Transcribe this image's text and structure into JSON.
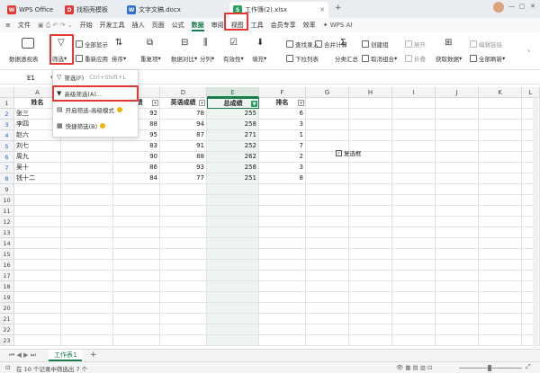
{
  "tabs": [
    {
      "label": "WPS Office",
      "icon": "wps-logo-icon"
    },
    {
      "label": "找稻壳模板",
      "icon": "docer-icon"
    },
    {
      "label": "文字文稿.docx",
      "icon": "word-doc-icon"
    },
    {
      "label": "工作簿(2).xlsx",
      "icon": "spreadsheet-icon"
    }
  ],
  "menu": [
    "文件",
    "开始",
    "开发工具",
    "插入",
    "页面",
    "公式",
    "数据",
    "审阅",
    "视图",
    "工具",
    "会员专享",
    "效率"
  ],
  "menu_active": "数据",
  "wps_ai": "WPS AI",
  "share": "分享",
  "ribbon": {
    "pivot": "数据透视表",
    "filter": "筛选",
    "show_all": "全部显示",
    "reapply": "重新应用",
    "sort": "排序",
    "repeat": "重复项",
    "compare": "数据对比",
    "split": "分列",
    "validity": "有效性",
    "fill": "填充",
    "find_entry": "查找录入",
    "merge_calc": "合并计算",
    "dropdown_list": "下拉列表",
    "create_group": "创建组",
    "expand": "展开",
    "subtotal": "分类汇总",
    "ungroup": "取消组合",
    "collapse": "折叠",
    "edit_link": "编辑链接",
    "get_data": "获取数据",
    "refresh_all": "全部刷新"
  },
  "namebox": "E1",
  "columns": [
    "A",
    "B",
    "C",
    "D",
    "E",
    "F",
    "G",
    "H",
    "I",
    "J",
    "K",
    "L"
  ],
  "headers": {
    "a": "姓名",
    "c": "成绩",
    "d": "英语成绩",
    "e": "总成绩",
    "f": "排名"
  },
  "rows": [
    {
      "num": "1"
    },
    {
      "num": "2",
      "name": "张三",
      "c": "92",
      "d": "78",
      "e": "255",
      "f": "6"
    },
    {
      "num": "3",
      "name": "李四",
      "c": "88",
      "d": "94",
      "e": "258",
      "f": "3"
    },
    {
      "num": "4",
      "name": "赵六",
      "c": "95",
      "d": "87",
      "e": "271",
      "f": "1"
    },
    {
      "num": "5",
      "name": "刘七",
      "c": "83",
      "d": "91",
      "e": "252",
      "f": "7"
    },
    {
      "num": "6",
      "name": "周九",
      "c": "90",
      "d": "88",
      "e": "262",
      "f": "2"
    },
    {
      "num": "7",
      "name": "吴十",
      "c": "86",
      "d": "93",
      "e": "258",
      "f": "3"
    },
    {
      "num": "8",
      "name": "钱十二",
      "c": "84",
      "d": "77",
      "e": "251",
      "f": "8"
    },
    {
      "num": "9"
    },
    {
      "num": "10"
    },
    {
      "num": "11"
    },
    {
      "num": "12"
    },
    {
      "num": "13"
    },
    {
      "num": "14"
    },
    {
      "num": "15"
    },
    {
      "num": "16"
    },
    {
      "num": "17"
    },
    {
      "num": "18"
    },
    {
      "num": "19"
    },
    {
      "num": "20"
    },
    {
      "num": "21"
    },
    {
      "num": "22"
    },
    {
      "num": "23"
    }
  ],
  "visible_b": [
    "0",
    "0",
    "0",
    "0",
    "0",
    "0",
    "0"
  ],
  "checkbox_label": "复选框",
  "dropdown": {
    "filter": "筛选(F)",
    "filter_shortcut": "Ctrl+Shift+L",
    "advanced": "高级筛选(A)...",
    "advanced_mode": "开启筛选-高级模式",
    "quick": "快捷筛选(B)"
  },
  "sheet_tab": "工作表1",
  "status": "在 10 个记录中筛选出 7 个",
  "colors": {
    "accent": "#1a7d4e",
    "highlight": "#e53935",
    "selected_col": "#dbe8e0"
  }
}
